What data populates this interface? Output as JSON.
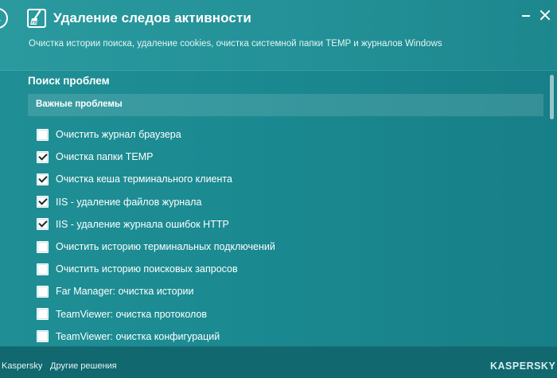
{
  "header": {
    "title": "Удаление следов активности",
    "subtitle": "Очистка истории поиска, удаление cookies, очистка системной папки TEMP и журналов Windows"
  },
  "section": {
    "title": "Поиск проблем",
    "group_title": "Важные проблемы"
  },
  "items": [
    {
      "label": "Очистить журнал браузера",
      "checked": false
    },
    {
      "label": "Очистка папки TEMP",
      "checked": true
    },
    {
      "label": "Очистка кеша терминального клиента",
      "checked": true
    },
    {
      "label": "IIS - удаление файлов журнала",
      "checked": true
    },
    {
      "label": "IIS - удаление журнала ошибок HTTP",
      "checked": true
    },
    {
      "label": "Очистить историю терминальных подключений",
      "checked": false
    },
    {
      "label": "Очистить историю поисковых запросов",
      "checked": false
    },
    {
      "label": "Far Manager: очистка истории",
      "checked": false
    },
    {
      "label": "TeamViewer: очистка протоколов",
      "checked": false
    },
    {
      "label": "TeamViewer: очистка конфигураций",
      "checked": false
    }
  ],
  "footer": {
    "link_left": "Kaspersky",
    "link_other": "Другие решения",
    "brand": "KASPERSKY"
  },
  "icons": {
    "back": "back-arrow-icon",
    "app": "broom-icon",
    "minimize": "minimize-icon",
    "close": "close-icon",
    "checkbox_checked": "checkmark-icon"
  },
  "colors": {
    "background": "#1b8a91",
    "header": "#239197",
    "footer": "#11686f",
    "text": "#ffffff"
  }
}
